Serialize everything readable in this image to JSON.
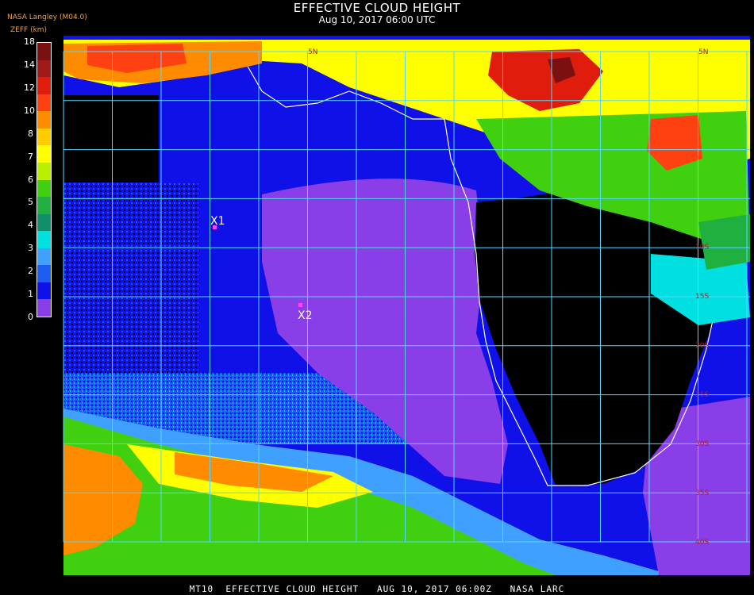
{
  "header": {
    "title": "EFFECTIVE CLOUD HEIGHT",
    "subtitle": "Aug 10, 2017 06:00 UTC",
    "source": "NASA Langley (M04.0)",
    "unit": "ZEFF (km)"
  },
  "legend": {
    "ticks": [
      "18",
      "14",
      "12",
      "10",
      "8",
      "7",
      "6",
      "5",
      "4",
      "3",
      "2",
      "1",
      "0"
    ],
    "colors": [
      "#7a1010",
      "#a01818",
      "#e01c0c",
      "#ff4010",
      "#ff8c00",
      "#ffcc00",
      "#ffff00",
      "#b8f000",
      "#40d010",
      "#20b040",
      "#10906a",
      "#00e0e0",
      "#40a0ff",
      "#1c5cf0",
      "#1010e8",
      "#8a3ee8"
    ]
  },
  "markers": [
    {
      "label": "X1"
    },
    {
      "label": "X2"
    }
  ],
  "grid": {
    "color": "#55d8ff",
    "label_color": "#b02020",
    "labels": [
      "5N",
      "5N",
      "10S",
      "15S",
      "20S",
      "25S",
      "30S",
      "35S",
      "40S"
    ]
  },
  "colors": {
    "ocean_low": "#1010e8",
    "low_cloud": "#8a3ee8",
    "clear": "#000000",
    "coast": "#ffffff"
  },
  "footer": {
    "text": "MT10  EFFECTIVE CLOUD HEIGHT   AUG 10, 2017 06:00Z   NASA LARC"
  }
}
